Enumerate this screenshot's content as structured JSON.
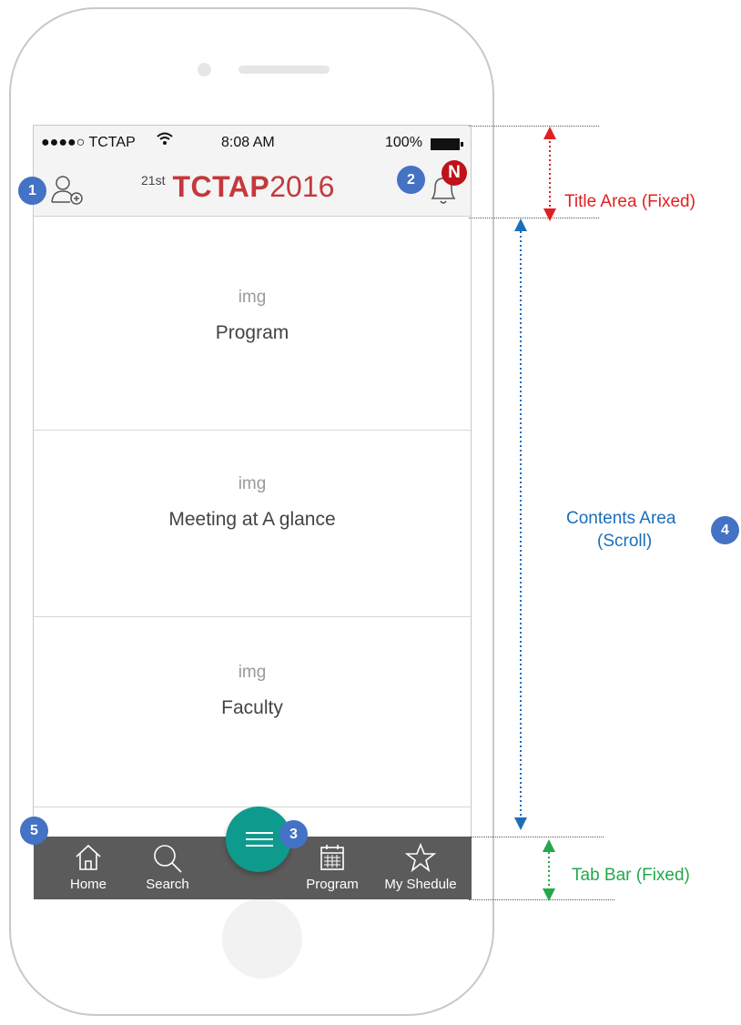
{
  "status_bar": {
    "carrier": "●●●●○ TCTAP",
    "time": "8:08 AM",
    "battery": "100%"
  },
  "header": {
    "logo_prefix": "21st",
    "logo_main": "TCTAP",
    "logo_year": "2016",
    "notification_badge": "N"
  },
  "menu_cards": [
    {
      "img_label": "img",
      "label": "Program"
    },
    {
      "img_label": "img",
      "label": "Meeting at A glance"
    },
    {
      "img_label": "img",
      "label": "Faculty"
    }
  ],
  "tab_bar": {
    "tabs": [
      {
        "label": "Home",
        "icon": "home-icon"
      },
      {
        "label": "Search",
        "icon": "search-icon"
      },
      {
        "label": "Program",
        "icon": "calendar-icon"
      },
      {
        "label": "My Shedule",
        "icon": "star-icon"
      }
    ],
    "fab_icon": "menu-icon",
    "bar_color": "#5b5b5b",
    "fab_color": "#0e9a8c"
  },
  "annotations": {
    "badges": [
      "1",
      "2",
      "3",
      "4",
      "5"
    ],
    "title_area": "Title Area (Fixed)",
    "contents_area_line1": "Contents Area",
    "contents_area_line2": "(Scroll)",
    "tab_bar": "Tab Bar (Fixed)",
    "colors": {
      "title": "#e02020",
      "contents": "#1a6fba",
      "tab": "#22a84a",
      "badge": "#4472c4"
    }
  }
}
